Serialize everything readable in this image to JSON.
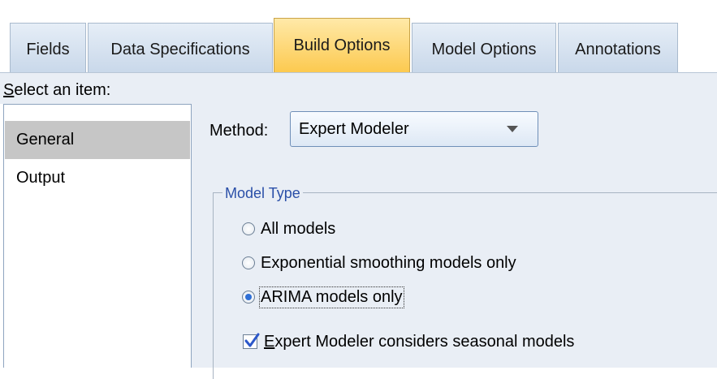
{
  "tabs": [
    {
      "label": "Fields",
      "active": false
    },
    {
      "label": "Data Specifications",
      "active": false
    },
    {
      "label": "Build Options",
      "active": true
    },
    {
      "label": "Model Options",
      "active": false
    },
    {
      "label": "Annotations",
      "active": false
    }
  ],
  "sidebar": {
    "prompt_first_letter": "S",
    "prompt_rest": "elect an item:",
    "items": [
      {
        "label": "General",
        "selected": true
      },
      {
        "label": "Output",
        "selected": false
      }
    ]
  },
  "method": {
    "label": "Method:",
    "value": "Expert Modeler"
  },
  "model_type": {
    "legend": "Model Type",
    "options": [
      {
        "label": "All models",
        "checked": false
      },
      {
        "label": "Exponential smoothing models only",
        "checked": false
      },
      {
        "label": "ARIMA models only",
        "checked": true
      }
    ],
    "seasonal_checkbox": {
      "label_first_letter": "E",
      "label_rest": "xpert Modeler considers seasonal models",
      "checked": true
    }
  },
  "colors": {
    "active_tab": "#fcc94e",
    "panel_bg": "#e9eef5",
    "legend_text": "#2a4fa8",
    "selected_item": "#c6c6c6",
    "check_mark": "#2b57c9"
  }
}
